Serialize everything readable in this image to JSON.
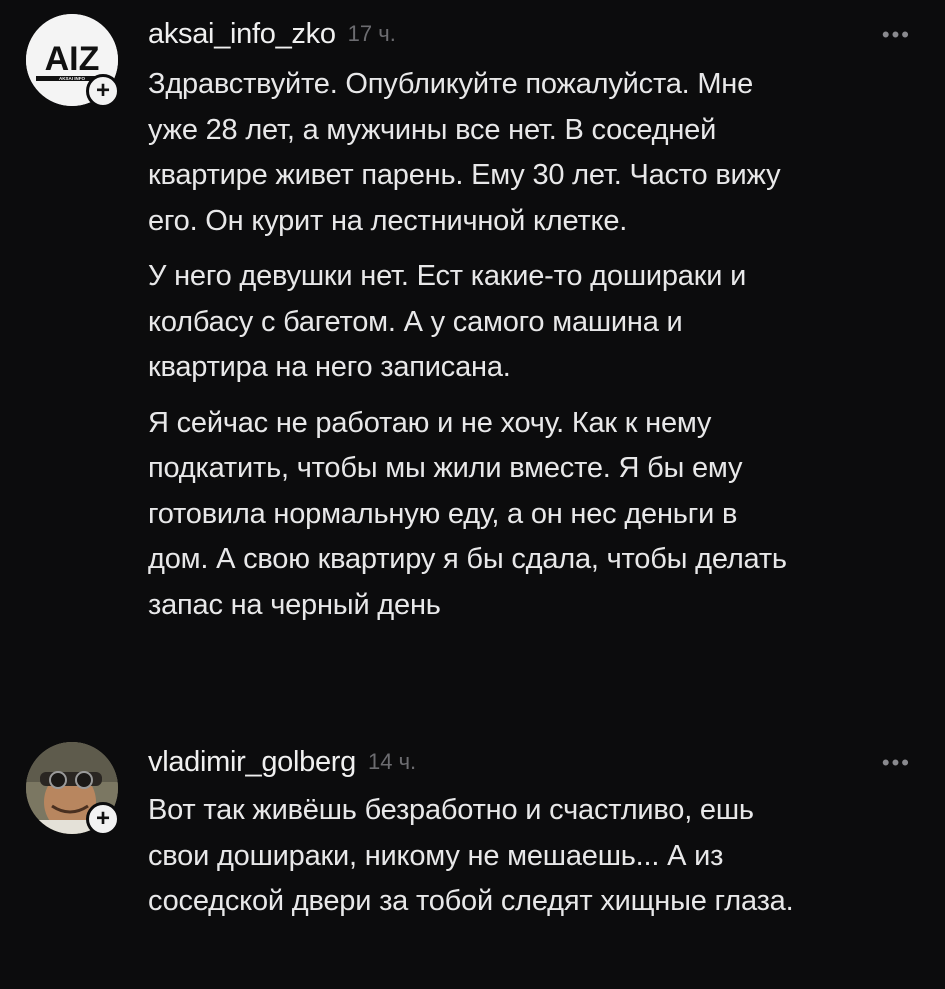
{
  "comments": [
    {
      "username": "aksai_info_zko",
      "time": "17 ч.",
      "avatar_icon": "aiz-logo",
      "avatar_text": "AIZ",
      "avatar_subtext": "AKSAI INFO",
      "lines": [
        "Здравствуйте. Опубликуйте пожалуйста. Мне",
        "уже 28 лет, а мужчины все нет. В соседней",
        "квартире живет парень. Ему 30 лет. Часто вижу",
        "его. Он курит на лестничной клетке.",
        "У него девушки нет. Ест какие-то дошираки и",
        "колбасу с багетом. А у самого машина и",
        "квартира на него записана.",
        "Я сейчас не работаю и не хочу. Как к нему",
        "подкатить, чтобы мы жили вместе. Я бы ему",
        "готовила нормальную еду, а он нес деньги в",
        "дом. А свою квартиру я бы сдала, чтобы делать",
        "запас на черный день"
      ]
    },
    {
      "username": "vladimir_golberg",
      "time": "14 ч.",
      "avatar_icon": "user-photo",
      "lines": [
        "Вот так живёшь безработно и счастливо, ешь",
        "свои дошираки, никому не мешаешь... А из",
        "соседской двери за тобой следят хищные глаза."
      ]
    }
  ],
  "ui": {
    "more_icon": "•••",
    "add_icon": "+"
  }
}
